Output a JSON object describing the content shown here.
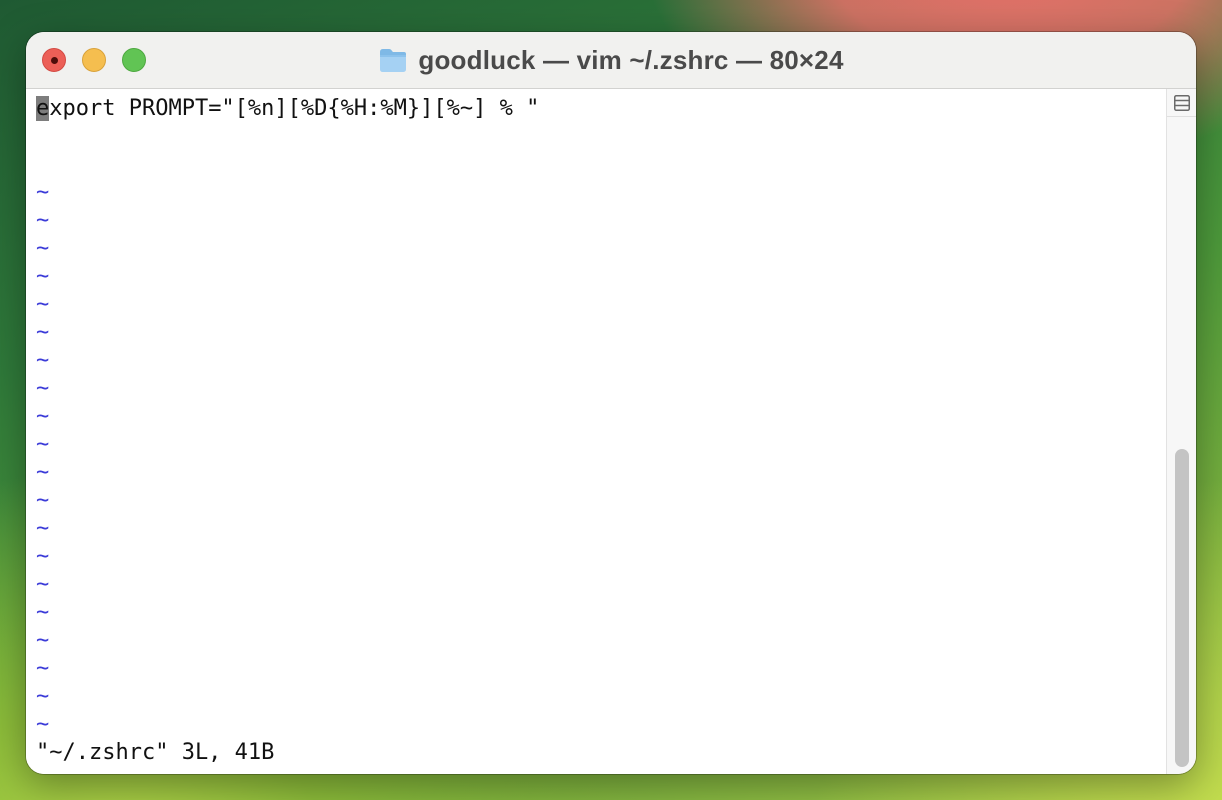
{
  "window": {
    "title": "goodluck — vim ~/.zshrc — 80×24",
    "controls": [
      "close",
      "minimize",
      "zoom"
    ]
  },
  "editor": {
    "first_line": {
      "cursor_char": "e",
      "rest": "xport PROMPT=\"[%n][%D{%H:%M}][%~] % \""
    },
    "empty_line_marker": "~",
    "empty_line_count": 20,
    "status_message": "\"~/.zshrc\" 3L, 41B"
  },
  "colors": {
    "tilde": "#3b3bd8",
    "cursor_bg": "#7d7d7d"
  },
  "icons": {
    "title_icon": "folder-icon",
    "split_icon": "split-view-icon"
  }
}
